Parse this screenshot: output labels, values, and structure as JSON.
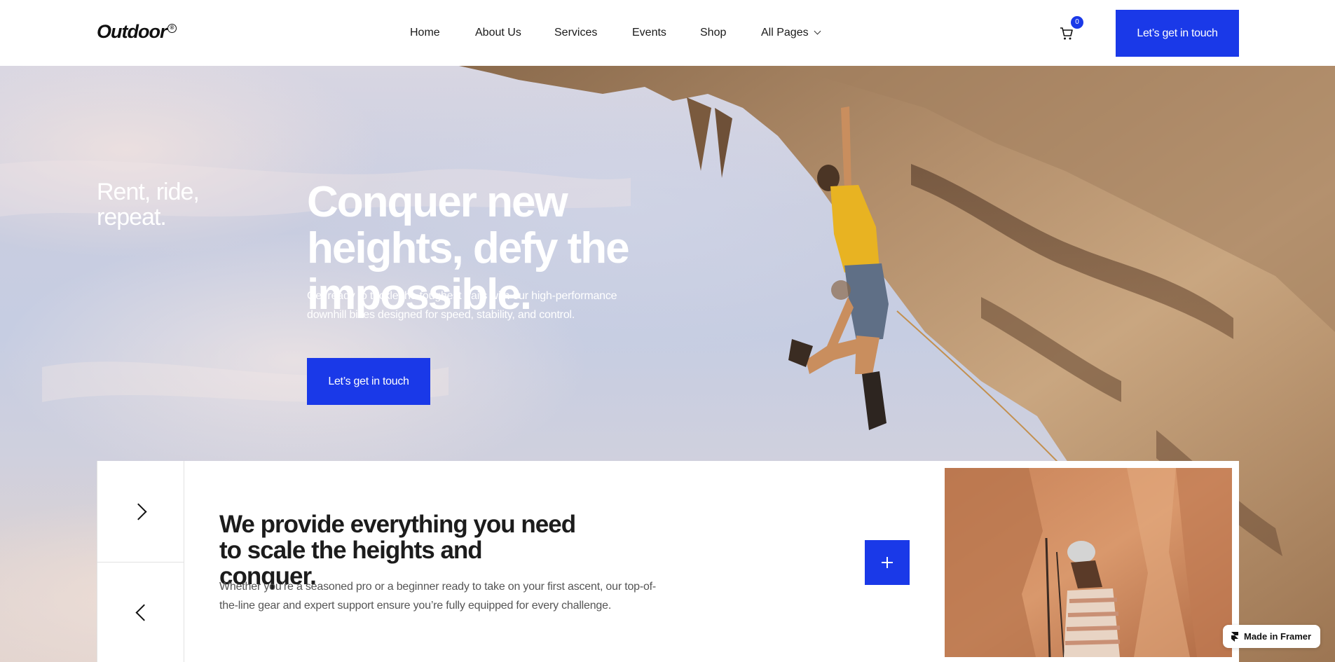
{
  "brand": {
    "logo": "Outdoor",
    "logo_mark": "®",
    "accent": "#1a39e8"
  },
  "nav": {
    "items": [
      {
        "label": "Home"
      },
      {
        "label": "About Us"
      },
      {
        "label": "Services"
      },
      {
        "label": "Events"
      },
      {
        "label": "Shop"
      },
      {
        "label": "All Pages"
      }
    ],
    "cart_count": "0",
    "cta_label": "Let’s get in touch",
    "icons": [
      "cart-icon",
      "chevron-down-icon"
    ]
  },
  "hero": {
    "tagline": "Rent, ride, repeat.",
    "headline": "Conquer new heights, defy the impossible.",
    "subtext": "Get ready to tackle the toughest trails with our high-performance downhill bikes designed for speed, stability, and control.",
    "cta_label": "Let’s get in touch"
  },
  "feature": {
    "title": "We provide everything you need to scale the heights and conquer.",
    "text": "Whether you’re a seasoned pro or a beginner ready to take on your first ascent, our top-of-the-line gear and expert support ensure you’re fully equipped for every challenge.",
    "icons": [
      "chevron-right-icon",
      "chevron-left-icon",
      "plus-icon"
    ]
  },
  "badge": {
    "label": "Made in Framer"
  }
}
